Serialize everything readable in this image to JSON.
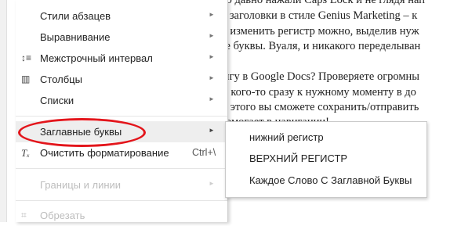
{
  "document_lines": [
    "ную давно нажали Caps Lock и не глядя нап",
    "ете заголовки в стиле Genius Marketing – к",
    "аев изменить регистр можно, выделив нуж",
    "ные буквы. Вуаля, и никакого переделыван",
    "книгу в Google Docs? Проверяете огромны",
    "ить кого-то сразу к нужному моменту в до",
    "сле этого вы сможете сохранить/отправить",
    "ь помогает в навигации!"
  ],
  "menu": {
    "items": [
      {
        "label": "Стили абзацев",
        "arrow": "►"
      },
      {
        "label": "Выравнивание",
        "arrow": "►"
      },
      {
        "label": "Межстрочный интервал",
        "arrow": "►",
        "icon": "line-spacing-icon",
        "glyph": "↕≡"
      },
      {
        "label": "Столбцы",
        "arrow": "►",
        "icon": "columns-icon",
        "glyph": "▥"
      },
      {
        "label": "Списки",
        "arrow": "►"
      },
      {
        "label": "Заглавные буквы",
        "arrow": "►"
      },
      {
        "label": "Очистить форматирование",
        "shortcut": "Ctrl+\\",
        "icon": "clear-formatting-icon",
        "glyph": "Tₓ"
      },
      {
        "label": "Границы и линии",
        "arrow": "►"
      },
      {
        "label": "Обрезать",
        "icon": "crop-icon",
        "glyph": "⌗"
      }
    ]
  },
  "submenu": {
    "items": [
      {
        "label": "нижний регистр"
      },
      {
        "label": "ВЕРХНИЙ РЕГИСТР"
      },
      {
        "label": "Каждое Слово С Заглавной Буквы"
      }
    ]
  },
  "colors": {
    "annotation": "#e3151b",
    "hover": "#eeeeee",
    "disabled": "#bdbdbd"
  }
}
